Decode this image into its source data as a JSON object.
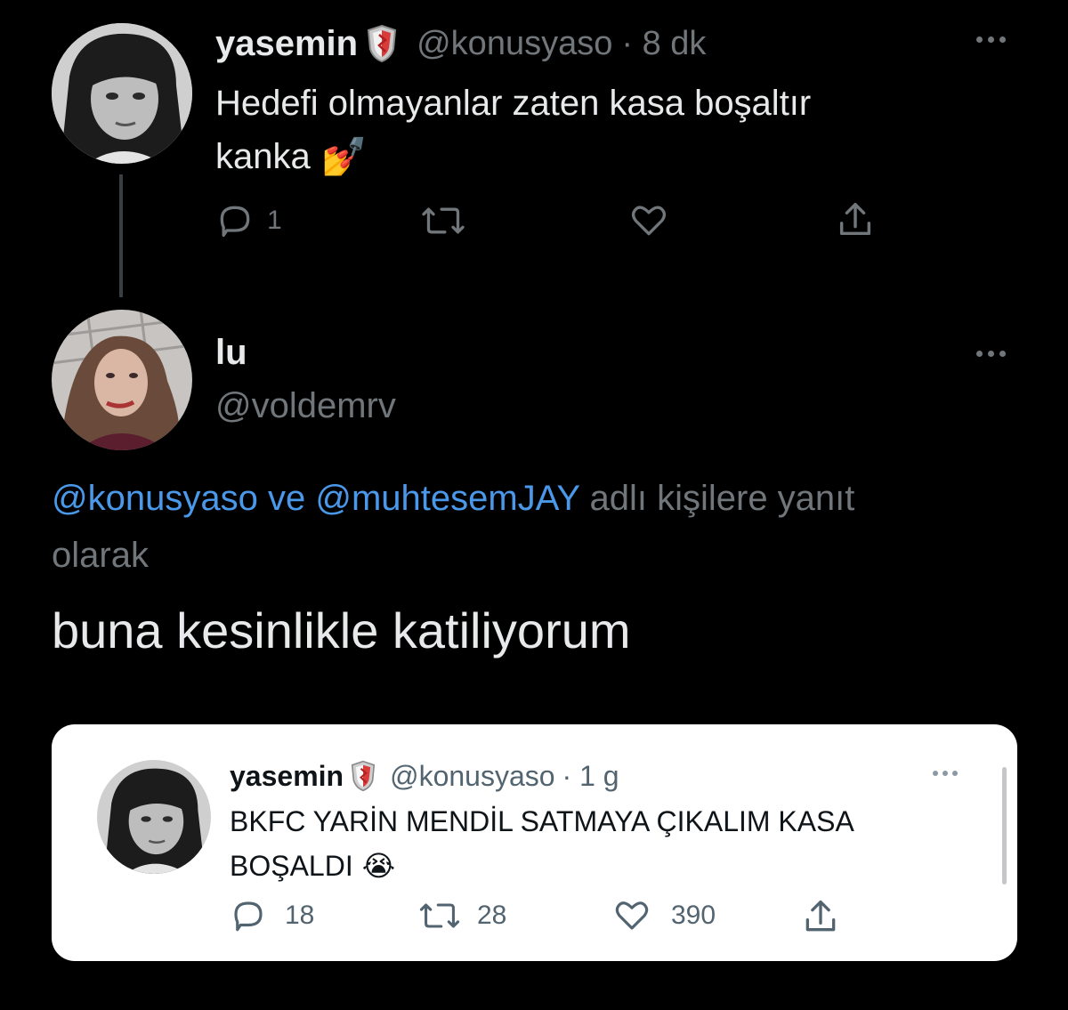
{
  "tweet1": {
    "name": "yasemin",
    "handle": "@konusyaso",
    "time": "· 8 dk",
    "text_line1": "Hedefi olmayanlar zaten kasa boşaltır",
    "text_line2": "kanka",
    "emoji": "💅",
    "reply_count": "1",
    "avatar_icon": "avatar-woman-bw",
    "badge_icon": "shield-badge-icon"
  },
  "tweet2": {
    "name": "lu",
    "handle": "@voldemrv",
    "reply_link1": "@konusyaso",
    "reply_ve": "ve",
    "reply_link2": "@muhtesemJAY",
    "reply_suffix": "adlı kişilere yanıt",
    "reply_suffix2": "olarak",
    "text": "buna kesinlikle katiliyorum"
  },
  "quoted": {
    "name": "yasemin",
    "handle": "@konusyaso",
    "time": "· 1 g",
    "text_line1": "BKFC YARİN MENDİL SATMAYA ÇIKALIM KASA",
    "text_line2": "BOŞALDI",
    "emoji": "😭",
    "reply_count": "18",
    "retweet_count": "28",
    "like_count": "390"
  },
  "colors": {
    "background": "#000000",
    "text": "#e7e9ea",
    "muted": "#71767b",
    "link": "#4a98e9",
    "card_bg": "#ffffff"
  }
}
